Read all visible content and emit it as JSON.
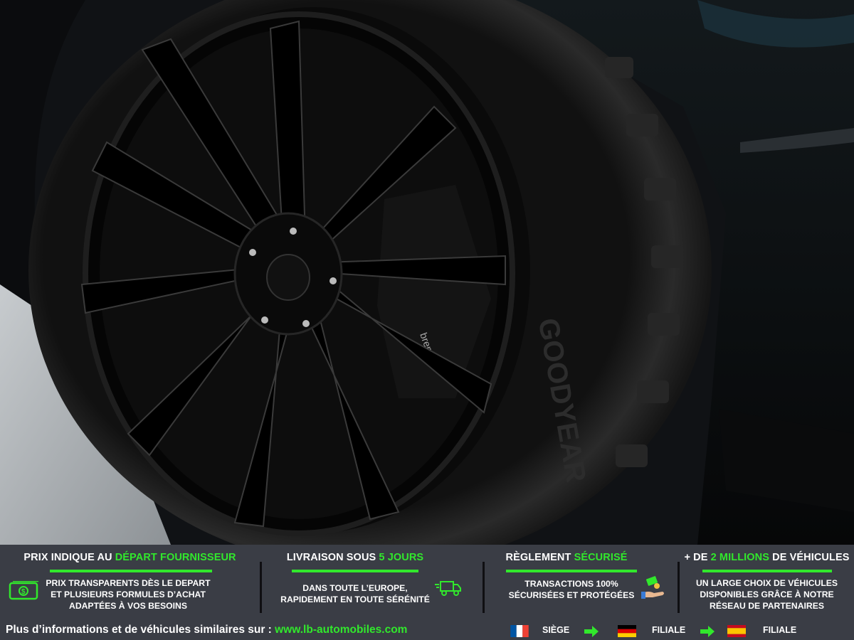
{
  "photo": {
    "description_icon": "car-wheel-photo"
  },
  "banner": {
    "columns": [
      {
        "title_pre": "PRIX INDIQUE AU ",
        "title_hl": "DÉPART FOURNISSEUR",
        "title_post": "",
        "desc": [
          "PRIX TRANSPARENTS DÈS LE DEPART",
          "ET PLUSIEURS FORMULES D’ACHAT",
          "ADAPTÉES À VOS BESOINS"
        ],
        "icon": "money-icon"
      },
      {
        "title_pre": "LIVRAISON SOUS ",
        "title_hl": "5 JOURS",
        "title_post": "",
        "desc": [
          "DANS TOUTE L’EUROPE,",
          "RAPIDEMENT EN TOUTE SÉRÉNITÉ"
        ],
        "icon": "delivery-truck-icon"
      },
      {
        "title_pre": "RÈGLEMENT ",
        "title_hl": "SÉCURISÉ",
        "title_post": "",
        "desc": [
          "TRANSACTIONS 100%",
          "SÉCURISÉES ET PROTÉGÉES"
        ],
        "icon": "payment-hand-icon"
      },
      {
        "title_pre": "+ DE ",
        "title_hl": "2 MILLIONS",
        "title_post": " DE VÉHICULES",
        "desc": [
          "UN LARGE CHOIX DE VÉHICULES",
          "DISPONIBLES GRÂCE À NOTRE",
          "RÉSEAU DE PARTENAIRES"
        ],
        "icon": ""
      }
    ],
    "footer": {
      "text": "Plus d’informations et de véhicules similaires sur : ",
      "url": "www.lb-automobiles.com",
      "locations": [
        {
          "flag": "france-flag-icon",
          "label": "SIÈGE"
        },
        {
          "flag": "germany-flag-icon",
          "label": "FILIALE"
        },
        {
          "flag": "spain-flag-icon",
          "label": "FILIALE"
        }
      ]
    },
    "accent_color": "#31e82c",
    "background_color": "#3a3d45"
  }
}
